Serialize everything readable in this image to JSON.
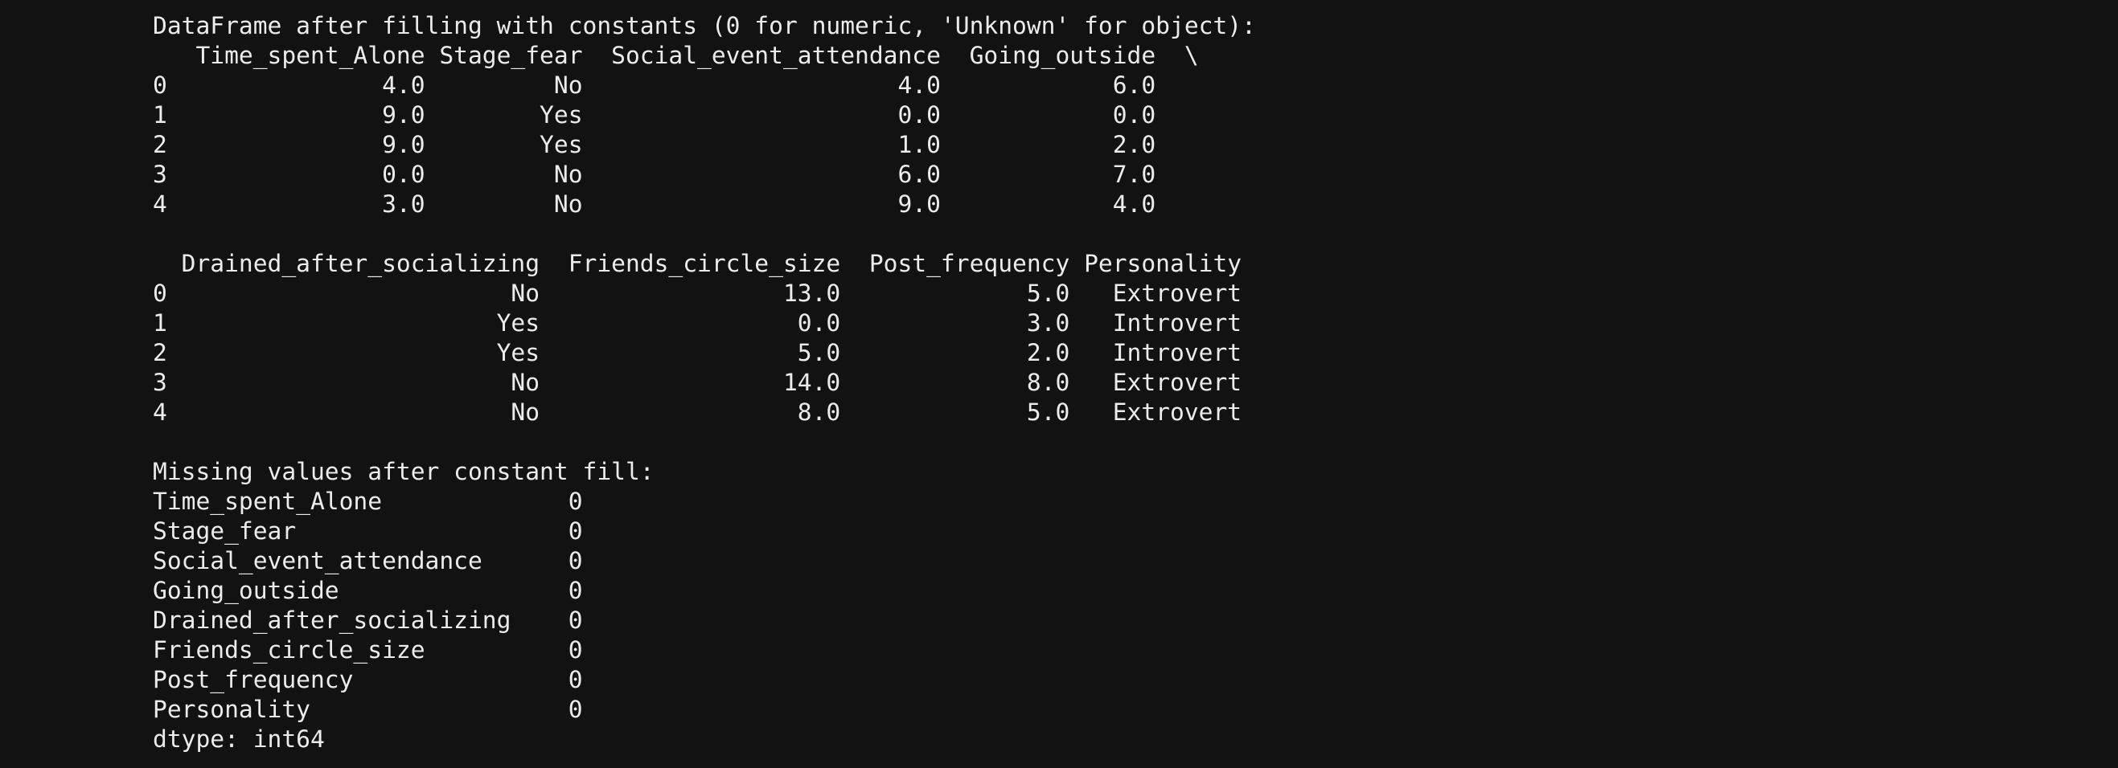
{
  "output": {
    "lines": [
      "DataFrame after filling with constants (0 for numeric, 'Unknown' for object):",
      "   Time_spent_Alone Stage_fear  Social_event_attendance  Going_outside  \\",
      "0               4.0         No                      4.0            6.0",
      "1               9.0        Yes                      0.0            0.0",
      "2               9.0        Yes                      1.0            2.0",
      "3               0.0         No                      6.0            7.0",
      "4               3.0         No                      9.0            4.0",
      "",
      "  Drained_after_socializing  Friends_circle_size  Post_frequency Personality",
      "0                        No                 13.0             5.0   Extrovert",
      "1                       Yes                  0.0             3.0   Introvert",
      "2                       Yes                  5.0             2.0   Introvert",
      "3                        No                 14.0             8.0   Extrovert",
      "4                        No                  8.0             5.0   Extrovert",
      "",
      "Missing values after constant fill:",
      "Time_spent_Alone             0",
      "Stage_fear                   0",
      "Social_event_attendance      0",
      "Going_outside                0",
      "Drained_after_socializing    0",
      "Friends_circle_size          0",
      "Post_frequency               0",
      "Personality                  0",
      "dtype: int64"
    ]
  }
}
